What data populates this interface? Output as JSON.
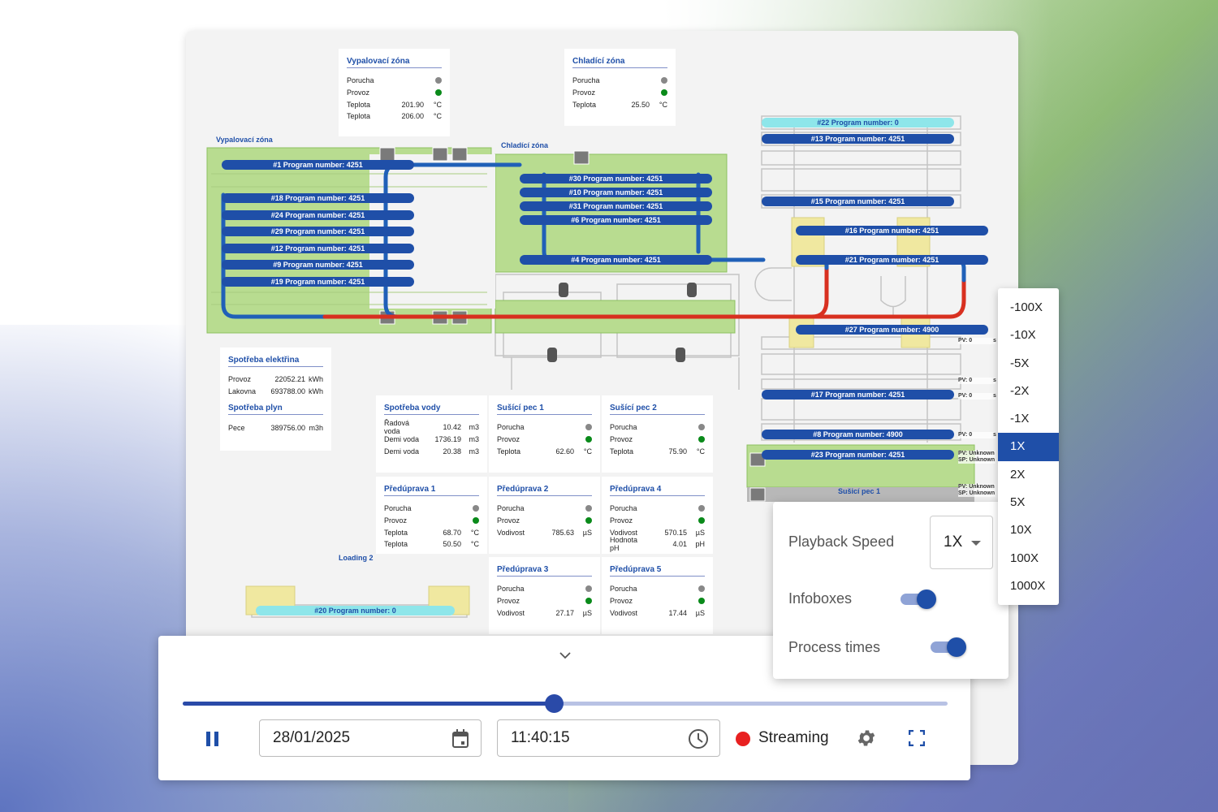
{
  "colors": {
    "accent": "#1f4fa8",
    "running": "#0a8a1a",
    "fault": "#888888",
    "streaming": "#e82020",
    "zone_green": "#b8dc90",
    "hot_pipe": "#d83020",
    "cold_pipe": "#2060b8"
  },
  "zones": {
    "firing_label": "Vypalovací zóna",
    "cooling_label": "Chladící zóna",
    "loading2_label": "Loading 2",
    "dryer_label": "Sušicí pec 1"
  },
  "programs": [
    "#1 Program number: 4251",
    "#18 Program number: 4251",
    "#24 Program number: 4251",
    "#29 Program number: 4251",
    "#12 Program number: 4251",
    "#9 Program number: 4251",
    "#19 Program number: 4251",
    "#30 Program number: 4251",
    "#10 Program number: 4251",
    "#31 Program number: 4251",
    "#6 Program number: 4251",
    "#4 Program number: 4251",
    "#22 Program number: 0",
    "#13 Program number: 4251",
    "#15 Program number: 4251",
    "#16 Program number: 4251",
    "#21 Program number: 4251",
    "#27 Program number: 4900",
    "#17 Program number: 4251",
    "#8 Program number: 4900",
    "#23 Program number: 4251",
    "#20 Program number: 0"
  ],
  "pv": [
    {
      "pv": "PV: 0",
      "unit": "s"
    },
    {
      "pv": "PV: 0",
      "unit": "s"
    },
    {
      "pv": "PV: 0",
      "unit": "s"
    },
    {
      "pv": "PV: 0",
      "unit": "s"
    },
    {
      "pv": "PV: Unknown",
      "sp": "SP: Unknown"
    },
    {
      "pv": "PV: Unknown",
      "sp": "SP: Unknown"
    }
  ],
  "infoboxes": [
    {
      "title": "Vypalovací zóna",
      "rows": [
        {
          "k": "Porucha",
          "status": "fault"
        },
        {
          "k": "Provoz",
          "status": "running"
        },
        {
          "k": "Teplota",
          "v": "201.90",
          "u": "°C"
        },
        {
          "k": "Teplota",
          "v": "206.00",
          "u": "°C"
        }
      ]
    },
    {
      "title": "Chladící zóna",
      "rows": [
        {
          "k": "Porucha",
          "status": "fault"
        },
        {
          "k": "Provoz",
          "status": "running"
        },
        {
          "k": "Teplota",
          "v": "25.50",
          "u": "°C"
        }
      ]
    },
    {
      "title": "Spotřeba vody",
      "rows": [
        {
          "k": "Řadová voda",
          "v": "10.42",
          "u": "m3"
        },
        {
          "k": "Demi voda",
          "v": "1736.19",
          "u": "m3"
        },
        {
          "k": "Demi voda",
          "v": "20.38",
          "u": "m3"
        }
      ]
    },
    {
      "title": "Sušící pec 1",
      "rows": [
        {
          "k": "Porucha",
          "status": "fault"
        },
        {
          "k": "Provoz",
          "status": "running"
        },
        {
          "k": "Teplota",
          "v": "62.60",
          "u": "°C"
        }
      ]
    },
    {
      "title": "Sušící pec 2",
      "rows": [
        {
          "k": "Porucha",
          "status": "fault"
        },
        {
          "k": "Provoz",
          "status": "running"
        },
        {
          "k": "Teplota",
          "v": "75.90",
          "u": "°C"
        }
      ]
    },
    {
      "title": "Předúprava 1",
      "rows": [
        {
          "k": "Porucha",
          "status": "fault"
        },
        {
          "k": "Provoz",
          "status": "running"
        },
        {
          "k": "Teplota",
          "v": "68.70",
          "u": "°C"
        },
        {
          "k": "Teplota",
          "v": "50.50",
          "u": "°C"
        }
      ]
    },
    {
      "title": "Předúprava 2",
      "rows": [
        {
          "k": "Porucha",
          "status": "fault"
        },
        {
          "k": "Provoz",
          "status": "running"
        },
        {
          "k": "Vodivost",
          "v": "785.63",
          "u": "µS"
        }
      ]
    },
    {
      "title": "Předúprava 4",
      "rows": [
        {
          "k": "Porucha",
          "status": "fault"
        },
        {
          "k": "Provoz",
          "status": "running"
        },
        {
          "k": "Vodivost",
          "v": "570.15",
          "u": "µS"
        },
        {
          "k": "Hodnota pH",
          "v": "4.01",
          "u": "pH"
        }
      ]
    },
    {
      "title": "Předúprava 3",
      "rows": [
        {
          "k": "Porucha",
          "status": "fault"
        },
        {
          "k": "Provoz",
          "status": "running"
        },
        {
          "k": "Vodivost",
          "v": "27.17",
          "u": "µS"
        }
      ]
    },
    {
      "title": "Předúprava 5",
      "rows": [
        {
          "k": "Porucha",
          "status": "fault"
        },
        {
          "k": "Provoz",
          "status": "running"
        },
        {
          "k": "Vodivost",
          "v": "17.44",
          "u": "µS"
        }
      ]
    }
  ],
  "energy": {
    "electricity_title": "Spotřeba elektřina",
    "electricity": [
      {
        "k": "Provoz",
        "v": "22052.21",
        "u": "kWh"
      },
      {
        "k": "Lakovna",
        "v": "693788.00",
        "u": "kWh"
      }
    ],
    "gas_title": "Spotřeba plyn",
    "gas": [
      {
        "k": "Pece",
        "v": "389756.00",
        "u": "m3h"
      }
    ]
  },
  "speed_menu": {
    "options": [
      "-100X",
      "-10X",
      "-5X",
      "-2X",
      "-1X",
      "1X",
      "2X",
      "5X",
      "10X",
      "100X",
      "1000X"
    ],
    "selected": "1X"
  },
  "settings": {
    "playback_label": "Playback Speed",
    "playback_value": "1X",
    "infoboxes_label": "Infoboxes",
    "infoboxes_on": true,
    "process_times_label": "Process times",
    "process_times_on": true
  },
  "player": {
    "progress_percent": 48.5,
    "date": "28/01/2025",
    "time": "11:40:15",
    "status": "Streaming",
    "icons": [
      "chevron-down-icon",
      "pause-icon",
      "calendar-icon",
      "clock-icon",
      "gear-icon",
      "fullscreen-icon"
    ]
  }
}
